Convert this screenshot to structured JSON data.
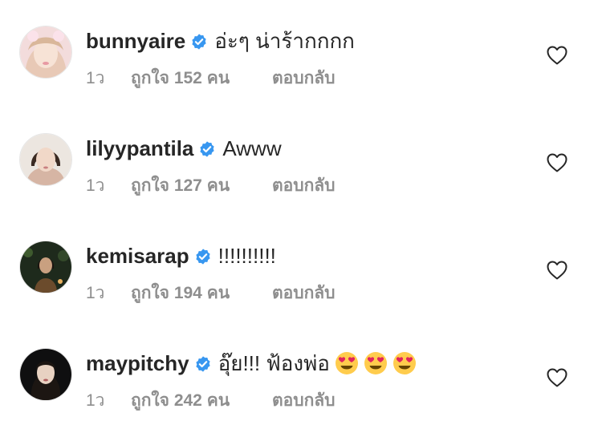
{
  "comments": [
    {
      "username": "bunnyaire",
      "text": "อ่ะๆ น่าร้ากกกก",
      "time": "1ว",
      "likes": "ถูกใจ 152 คน",
      "reply": "ตอบกลับ"
    },
    {
      "username": "lilyypantila",
      "text": "Awww",
      "time": "1ว",
      "likes": "ถูกใจ 127 คน",
      "reply": "ตอบกลับ"
    },
    {
      "username": "kemisarap",
      "text": "!!!!!!!!!!",
      "time": "1ว",
      "likes": "ถูกใจ 194 คน",
      "reply": "ตอบกลับ"
    },
    {
      "username": "maypitchy",
      "text": "อุ๊ย!!! ฟ้องพ่อ",
      "emojis": [
        "heart-eyes-emoji",
        "heart-eyes-emoji",
        "heart-eyes-emoji"
      ],
      "time": "1ว",
      "likes": "ถูกใจ 242 คน",
      "reply": "ตอบกลับ"
    }
  ],
  "colors": {
    "verified": "#3897f0",
    "meta": "#8e8e8e",
    "text": "#262626",
    "emoji_face": "#ffcc4d",
    "emoji_heart": "#e0245e"
  },
  "icons": {
    "verified": "verified-badge-icon",
    "like": "heart-outline-icon"
  }
}
